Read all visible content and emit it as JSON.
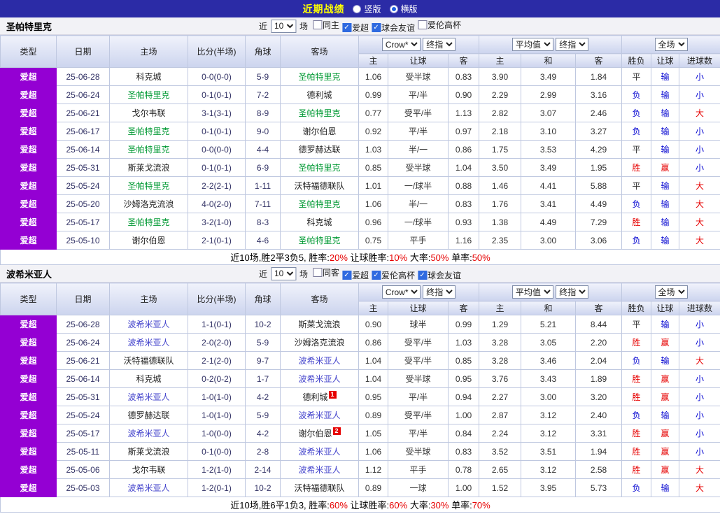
{
  "topbar": {
    "title": "近期战绩",
    "options": [
      {
        "label": "竖版",
        "selected": false
      },
      {
        "label": "横版",
        "selected": true
      }
    ]
  },
  "table": {
    "headers": [
      "类型",
      "日期",
      "主场",
      "比分(半场)",
      "角球",
      "客场"
    ],
    "odds_group": {
      "select1": "Crow*",
      "select2": "终指",
      "cols": [
        "主",
        "让球",
        "客"
      ]
    },
    "avg_group": {
      "select1": "平均值",
      "select2": "终指",
      "cols": [
        "主",
        "和",
        "客"
      ]
    },
    "result_group": {
      "select": "全场",
      "cols": [
        "胜负",
        "让球",
        "进球数"
      ]
    }
  },
  "sections": [
    {
      "team": "圣帕特里克",
      "filter": {
        "near": "近",
        "count": "10",
        "games": "场",
        "checkboxes": [
          {
            "label": "同主",
            "checked": false
          },
          {
            "label": "爱超",
            "checked": true
          },
          {
            "label": "球会友谊",
            "checked": true
          },
          {
            "label": "爱伦高杯",
            "checked": false
          }
        ]
      },
      "rows": [
        {
          "league": "爱超",
          "date": "25-06-28",
          "home": "科克城",
          "hf": false,
          "score": "0-0(0-0)",
          "corner": "5-9",
          "away": "圣帕特里克",
          "af": true,
          "o1": "1.06",
          "hcp": "受半球",
          "o2": "0.83",
          "a1": "3.90",
          "a2": "3.49",
          "a3": "1.84",
          "r1": "平",
          "r2": "输",
          "r3": "小"
        },
        {
          "league": "爱超",
          "date": "25-06-24",
          "home": "圣帕特里克",
          "hf": true,
          "score": "0-1(0-1)",
          "corner": "7-2",
          "away": "德利城",
          "af": false,
          "o1": "0.99",
          "hcp": "平/半",
          "o2": "0.90",
          "a1": "2.29",
          "a2": "2.99",
          "a3": "3.16",
          "r1": "负",
          "r2": "输",
          "r3": "小"
        },
        {
          "league": "爱超",
          "date": "25-06-21",
          "home": "戈尔韦联",
          "hf": false,
          "score": "3-1(3-1)",
          "corner": "8-9",
          "away": "圣帕特里克",
          "af": true,
          "o1": "0.77",
          "hcp": "受平/半",
          "o2": "1.13",
          "a1": "2.82",
          "a2": "3.07",
          "a3": "2.46",
          "r1": "负",
          "r2": "输",
          "r3": "大"
        },
        {
          "league": "爱超",
          "date": "25-06-17",
          "home": "圣帕特里克",
          "hf": true,
          "score": "0-1(0-1)",
          "corner": "9-0",
          "away": "谢尔伯恩",
          "af": false,
          "o1": "0.92",
          "hcp": "平/半",
          "o2": "0.97",
          "a1": "2.18",
          "a2": "3.10",
          "a3": "3.27",
          "r1": "负",
          "r2": "输",
          "r3": "小"
        },
        {
          "league": "爱超",
          "date": "25-06-14",
          "home": "圣帕特里克",
          "hf": true,
          "score": "0-0(0-0)",
          "corner": "4-4",
          "away": "德罗赫达联",
          "af": false,
          "o1": "1.03",
          "hcp": "半/一",
          "o2": "0.86",
          "a1": "1.75",
          "a2": "3.53",
          "a3": "4.29",
          "r1": "平",
          "r2": "输",
          "r3": "小"
        },
        {
          "league": "爱超",
          "date": "25-05-31",
          "home": "斯莱戈流浪",
          "hf": false,
          "score": "0-1(0-1)",
          "corner": "6-9",
          "away": "圣帕特里克",
          "af": true,
          "o1": "0.85",
          "hcp": "受半球",
          "o2": "1.04",
          "a1": "3.50",
          "a2": "3.49",
          "a3": "1.95",
          "r1": "胜",
          "r2": "赢",
          "r3": "小"
        },
        {
          "league": "爱超",
          "date": "25-05-24",
          "home": "圣帕特里克",
          "hf": true,
          "score": "2-2(2-1)",
          "corner": "1-11",
          "away": "沃特福德联队",
          "af": false,
          "o1": "1.01",
          "hcp": "一/球半",
          "o2": "0.88",
          "a1": "1.46",
          "a2": "4.41",
          "a3": "5.88",
          "r1": "平",
          "r2": "输",
          "r3": "大"
        },
        {
          "league": "爱超",
          "date": "25-05-20",
          "home": "沙姆洛克流浪",
          "hf": false,
          "score": "4-0(2-0)",
          "corner": "7-11",
          "away": "圣帕特里克",
          "af": true,
          "o1": "1.06",
          "hcp": "半/一",
          "o2": "0.83",
          "a1": "1.76",
          "a2": "3.41",
          "a3": "4.49",
          "r1": "负",
          "r2": "输",
          "r3": "大"
        },
        {
          "league": "爱超",
          "date": "25-05-17",
          "home": "圣帕特里克",
          "hf": true,
          "score": "3-2(1-0)",
          "corner": "8-3",
          "away": "科克城",
          "af": false,
          "o1": "0.96",
          "hcp": "一/球半",
          "o2": "0.93",
          "a1": "1.38",
          "a2": "4.49",
          "a3": "7.29",
          "r1": "胜",
          "r2": "输",
          "r3": "大"
        },
        {
          "league": "爱超",
          "date": "25-05-10",
          "home": "谢尔伯恩",
          "hf": false,
          "score": "2-1(0-1)",
          "corner": "4-6",
          "away": "圣帕特里克",
          "af": true,
          "o1": "0.75",
          "hcp": "平手",
          "o2": "1.16",
          "a1": "2.35",
          "a2": "3.00",
          "a3": "3.06",
          "r1": "负",
          "r2": "输",
          "r3": "大"
        }
      ],
      "summary": {
        "prefix": "近10场,胜2平3负5, ",
        "stats": [
          [
            "胜率:",
            "20%"
          ],
          [
            "让球胜率:",
            "10%"
          ],
          [
            "大率:",
            "50%"
          ],
          [
            "单率:",
            "50%"
          ]
        ]
      }
    },
    {
      "team": "波希米亚人",
      "filter": {
        "near": "近",
        "count": "10",
        "games": "场",
        "checkboxes": [
          {
            "label": "同客",
            "checked": false
          },
          {
            "label": "爱超",
            "checked": true
          },
          {
            "label": "爱伦高杯",
            "checked": true
          },
          {
            "label": "球会友谊",
            "checked": true
          }
        ]
      },
      "rows": [
        {
          "league": "爱超",
          "date": "25-06-28",
          "home": "波希米亚人",
          "hf": true,
          "score": "1-1(0-1)",
          "corner": "10-2",
          "away": "斯莱戈流浪",
          "af": false,
          "o1": "0.90",
          "hcp": "球半",
          "o2": "0.99",
          "a1": "1.29",
          "a2": "5.21",
          "a3": "8.44",
          "r1": "平",
          "r2": "输",
          "r3": "小"
        },
        {
          "league": "爱超",
          "date": "25-06-24",
          "home": "波希米亚人",
          "hf": true,
          "score": "2-0(2-0)",
          "corner": "5-9",
          "away": "沙姆洛克流浪",
          "af": false,
          "o1": "0.86",
          "hcp": "受平/半",
          "o2": "1.03",
          "a1": "3.28",
          "a2": "3.05",
          "a3": "2.20",
          "r1": "胜",
          "r2": "赢",
          "r3": "小"
        },
        {
          "league": "爱超",
          "date": "25-06-21",
          "home": "沃特福德联队",
          "hf": false,
          "score": "2-1(2-0)",
          "corner": "9-7",
          "away": "波希米亚人",
          "af": true,
          "o1": "1.04",
          "hcp": "受平/半",
          "o2": "0.85",
          "a1": "3.28",
          "a2": "3.46",
          "a3": "2.04",
          "r1": "负",
          "r2": "输",
          "r3": "大"
        },
        {
          "league": "爱超",
          "date": "25-06-14",
          "home": "科克城",
          "hf": false,
          "score": "0-2(0-2)",
          "corner": "1-7",
          "away": "波希米亚人",
          "af": true,
          "o1": "1.04",
          "hcp": "受半球",
          "o2": "0.95",
          "a1": "3.76",
          "a2": "3.43",
          "a3": "1.89",
          "r1": "胜",
          "r2": "赢",
          "r3": "小"
        },
        {
          "league": "爱超",
          "date": "25-05-31",
          "home": "波希米亚人",
          "hf": true,
          "score": "1-0(1-0)",
          "corner": "4-2",
          "away": "德利城",
          "af": false,
          "ab": "1",
          "o1": "0.95",
          "hcp": "平/半",
          "o2": "0.94",
          "a1": "2.27",
          "a2": "3.00",
          "a3": "3.20",
          "r1": "胜",
          "r2": "赢",
          "r3": "小"
        },
        {
          "league": "爱超",
          "date": "25-05-24",
          "home": "德罗赫达联",
          "hf": false,
          "score": "1-0(1-0)",
          "corner": "5-9",
          "away": "波希米亚人",
          "af": true,
          "o1": "0.89",
          "hcp": "受平/半",
          "o2": "1.00",
          "a1": "2.87",
          "a2": "3.12",
          "a3": "2.40",
          "r1": "负",
          "r2": "输",
          "r3": "小"
        },
        {
          "league": "爱超",
          "date": "25-05-17",
          "home": "波希米亚人",
          "hf": true,
          "score": "1-0(0-0)",
          "corner": "4-2",
          "away": "谢尔伯恩",
          "af": false,
          "ab": "2",
          "o1": "1.05",
          "hcp": "平/半",
          "o2": "0.84",
          "a1": "2.24",
          "a2": "3.12",
          "a3": "3.31",
          "r1": "胜",
          "r2": "赢",
          "r3": "小"
        },
        {
          "league": "爱超",
          "date": "25-05-11",
          "home": "斯莱戈流浪",
          "hf": false,
          "score": "0-1(0-0)",
          "corner": "2-8",
          "away": "波希米亚人",
          "af": true,
          "o1": "1.06",
          "hcp": "受半球",
          "o2": "0.83",
          "a1": "3.52",
          "a2": "3.51",
          "a3": "1.94",
          "r1": "胜",
          "r2": "赢",
          "r3": "小"
        },
        {
          "league": "爱超",
          "date": "25-05-06",
          "home": "戈尔韦联",
          "hf": false,
          "score": "1-2(1-0)",
          "corner": "2-14",
          "away": "波希米亚人",
          "af": true,
          "o1": "1.12",
          "hcp": "平手",
          "o2": "0.78",
          "a1": "2.65",
          "a2": "3.12",
          "a3": "2.58",
          "r1": "胜",
          "r2": "赢",
          "r3": "大"
        },
        {
          "league": "爱超",
          "date": "25-05-03",
          "home": "波希米亚人",
          "hf": true,
          "score": "1-2(0-1)",
          "corner": "10-2",
          "away": "沃特福德联队",
          "af": false,
          "o1": "0.89",
          "hcp": "一球",
          "o2": "1.00",
          "a1": "1.52",
          "a2": "3.95",
          "a3": "5.73",
          "r1": "负",
          "r2": "输",
          "r3": "大"
        }
      ],
      "summary": {
        "prefix": "近10场,胜6平1负3, ",
        "stats": [
          [
            "胜率:",
            "60%"
          ],
          [
            "让球胜率:",
            "60%"
          ],
          [
            "大率:",
            "30%"
          ],
          [
            "单率:",
            "70%"
          ]
        ]
      }
    }
  ]
}
